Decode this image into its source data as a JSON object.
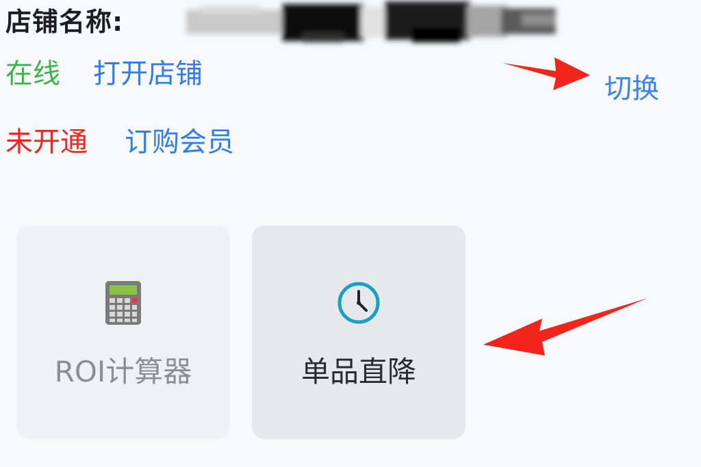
{
  "store": {
    "name_label": "店铺名称:"
  },
  "status": {
    "online_label": "在线",
    "open_store_link": "打开店铺",
    "not_open_label": "未开通",
    "subscribe_link": "订购会员",
    "switch_link": "切换"
  },
  "tools": [
    {
      "label": "ROI计算器",
      "icon": "calculator-icon"
    },
    {
      "label": "单品直降",
      "icon": "clock-icon"
    }
  ],
  "colors": {
    "online": "#3ab54a",
    "link": "#2f7cf6",
    "not_open": "#f0261e",
    "annotation_arrow": "#f2241b"
  }
}
